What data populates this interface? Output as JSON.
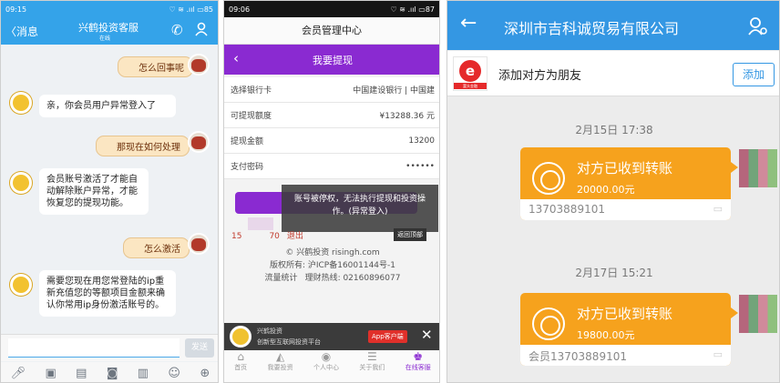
{
  "left": {
    "status": {
      "time": "09:15",
      "right": "♡ ≋ .ııl ▭85"
    },
    "header": {
      "back": "〈消息",
      "title": "兴鹤投资客服",
      "subtitle": "在线"
    },
    "messages": [
      {
        "from": "me",
        "text": "怎么回事呢"
      },
      {
        "from": "service",
        "text": "亲，你会员用户异常登入了"
      },
      {
        "from": "me",
        "text": "那现在如何处理"
      },
      {
        "from": "service",
        "text": "会员账号激活了才能自动解除账户异常，才能恢复您的提现功能。"
      },
      {
        "from": "me",
        "text": "怎么激活"
      },
      {
        "from": "service",
        "text": "需要您现在用您常登陆的ip重新充值您的等额项目金额来确认你常用ip身份激活账号的。"
      }
    ],
    "send": "发送"
  },
  "middle": {
    "status": {
      "time": "09:06",
      "right": "♡ ≋ .ııl ▭87"
    },
    "page_title": "会员管理中心",
    "purple_title": "我要提现",
    "form": [
      {
        "label": "选择银行卡",
        "value": "中国建设银行 | 中国建"
      },
      {
        "label": "可提现额度",
        "value": "¥13288.36 元"
      },
      {
        "label": "提现金额",
        "value": "13200"
      },
      {
        "label": "支付密码",
        "value": "••••••"
      }
    ],
    "toast": "账号被停权，无法执行提现和投资操作。(异常登入)",
    "user_prefix": "15",
    "user_suffix": "70",
    "logout": "退出",
    "back_top": "返回顶部",
    "footer": {
      "copyright": "© 兴鹤投资 risingh.com",
      "icp": "版权所有: 沪ICP备16001144号-1",
      "stats": "流量统计",
      "hotline": "理财热线: 02160896077"
    },
    "banner": {
      "name": "兴鹤投资",
      "slogan": "创新型互联网投资平台",
      "app": "App客户端"
    },
    "nav": [
      "首页",
      "我要投资",
      "个人中心",
      "关于我们",
      "在线客服"
    ]
  },
  "right": {
    "header": {
      "title": "深圳市吉科诚贸易有限公司"
    },
    "friend": {
      "text": "添加对方为朋友",
      "button": "添加",
      "logo_text": "富头金融"
    },
    "transfers": [
      {
        "time": "2月15日 17:38",
        "title": "对方已收到转账",
        "amount": "20000.00元",
        "sender": "13703889101"
      },
      {
        "time": "2月17日 15:21",
        "title": "对方已收到转账",
        "amount": "19800.00元",
        "sender": "会员13703889101"
      }
    ]
  },
  "colors": {
    "qq_blue": "#35a7ea",
    "purple": "#8a2ad1",
    "wechat_blue": "#3497e3",
    "orange": "#f6a21d"
  }
}
